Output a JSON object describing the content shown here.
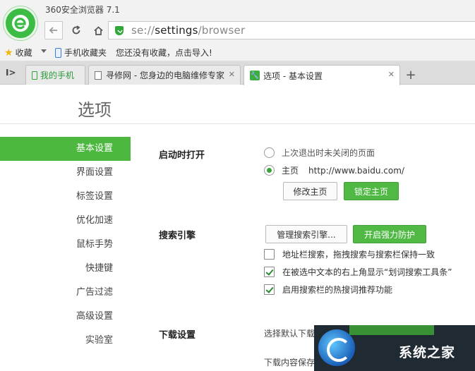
{
  "window": {
    "title": "360安全浏览器 7.1"
  },
  "addressbar": {
    "url_scheme": "se://",
    "url_host": "settings",
    "url_path": "/browser"
  },
  "bookmarks": {
    "favorites_label": "收藏",
    "mobile_label": "手机收藏夹",
    "hint": "您还没有收藏，点击导入!"
  },
  "tabs": [
    {
      "label": "我的手机"
    },
    {
      "label": "寻修网 - 您身边的电脑维修专家"
    },
    {
      "label": "选项 - 基本设置"
    }
  ],
  "page": {
    "title": "选项"
  },
  "sidebar": {
    "items": [
      {
        "label": "基本设置",
        "active": true
      },
      {
        "label": "界面设置"
      },
      {
        "label": "标签设置"
      },
      {
        "label": "优化加速"
      },
      {
        "label": "鼠标手势"
      },
      {
        "label": "快捷键"
      },
      {
        "label": "广告过滤"
      },
      {
        "label": "高级设置"
      },
      {
        "label": "实验室"
      }
    ]
  },
  "startup": {
    "label": "启动时打开",
    "option_last": "上次退出时未关闭的页面",
    "option_home": "主页",
    "homepage_url": "http://www.baidu.com/",
    "modify_button": "修改主页",
    "lock_button": "锁定主页"
  },
  "search": {
    "label": "搜索引擎",
    "manage_button": "管理搜索引擎...",
    "protect_button": "开启强力防护",
    "opt_sync": "地址栏搜索，拖拽搜索与搜索栏保持一致",
    "opt_toolbar": "在被选中文本的右上角显示“划词搜索工具条”",
    "opt_hot": "启用搜索栏的热搜词推荐功能"
  },
  "download": {
    "label": "下载设置",
    "line1": "选择默认下载",
    "line2": "下载内容保存"
  },
  "watermark": {
    "text": "系统之家"
  }
}
